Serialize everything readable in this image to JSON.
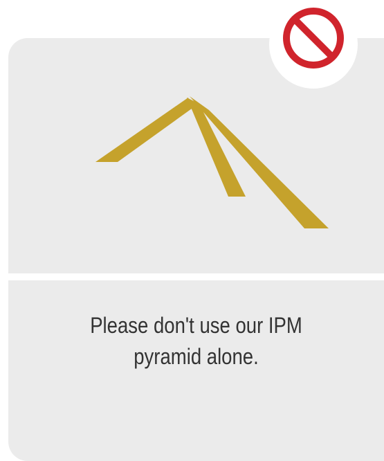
{
  "caption": {
    "line1": "Please don't use our IPM",
    "line2": "pyramid alone."
  },
  "colors": {
    "card_background": "#ebebeb",
    "pyramid_gold": "#c5a22c",
    "prohibited_red": "#d0242c",
    "caption_text": "#333333"
  },
  "icons": {
    "prohibited": "prohibited-icon",
    "pyramid": "ipm-pyramid-graphic"
  }
}
